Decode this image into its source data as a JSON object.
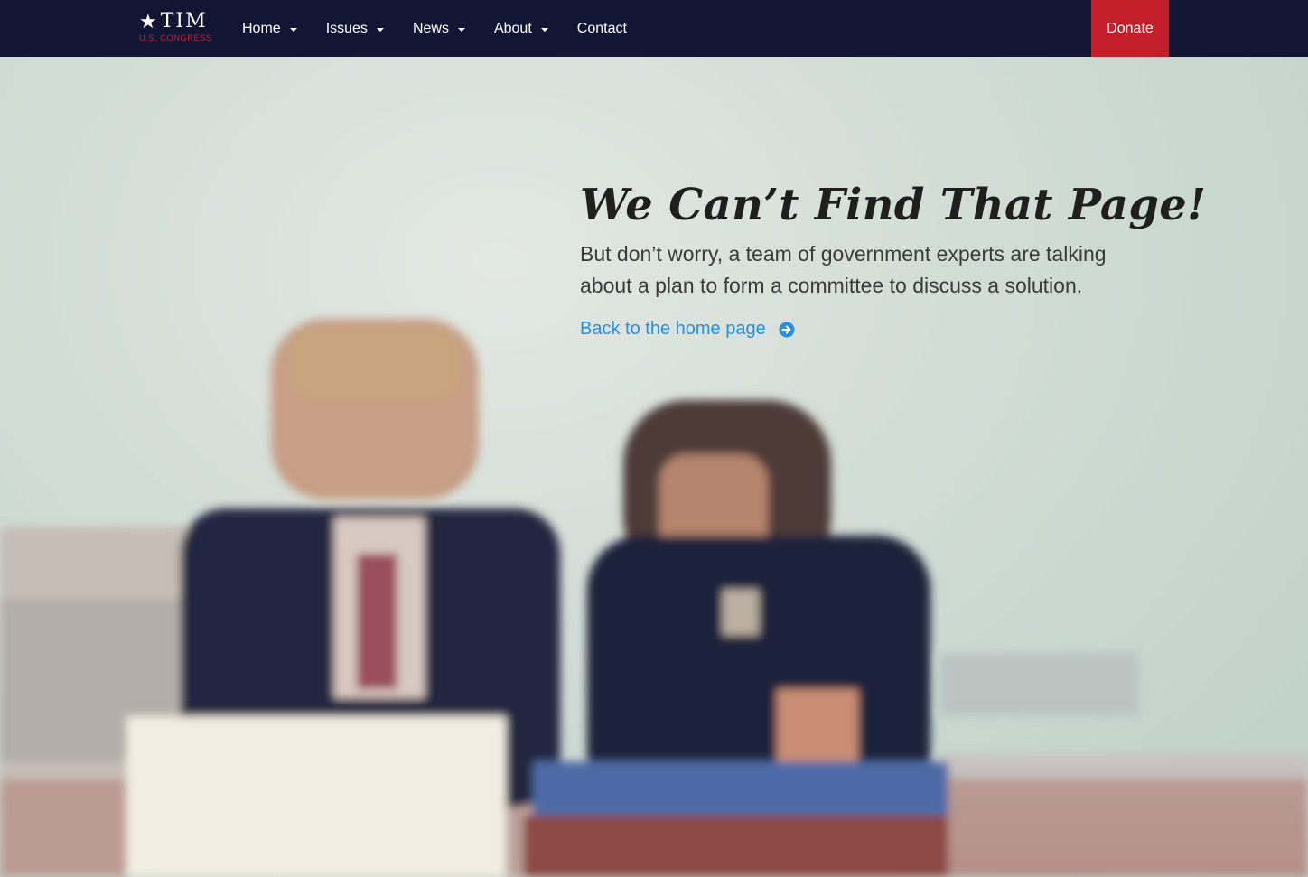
{
  "brand": {
    "star": "★",
    "name": "TIM",
    "subtitle": "U.S. CONGRESS",
    "accent_color": "#c8202d",
    "nav_bg": "#131535"
  },
  "nav": {
    "items": [
      {
        "label": "Home",
        "has_dropdown": true
      },
      {
        "label": "Issues",
        "has_dropdown": true
      },
      {
        "label": "News",
        "has_dropdown": true
      },
      {
        "label": "About",
        "has_dropdown": true
      },
      {
        "label": "Contact",
        "has_dropdown": false
      }
    ],
    "donate_label": "Donate",
    "donate_color": "#c31f2a"
  },
  "error": {
    "headline": "We Can’t Find That Page!",
    "message": "But don’t worry, a team of government experts are talking about a plan to form a committee to discuss a solution.",
    "link_label": "Back to the home page",
    "link_icon": "arrow-circle-right-icon",
    "link_color": "#2b8fdc"
  }
}
